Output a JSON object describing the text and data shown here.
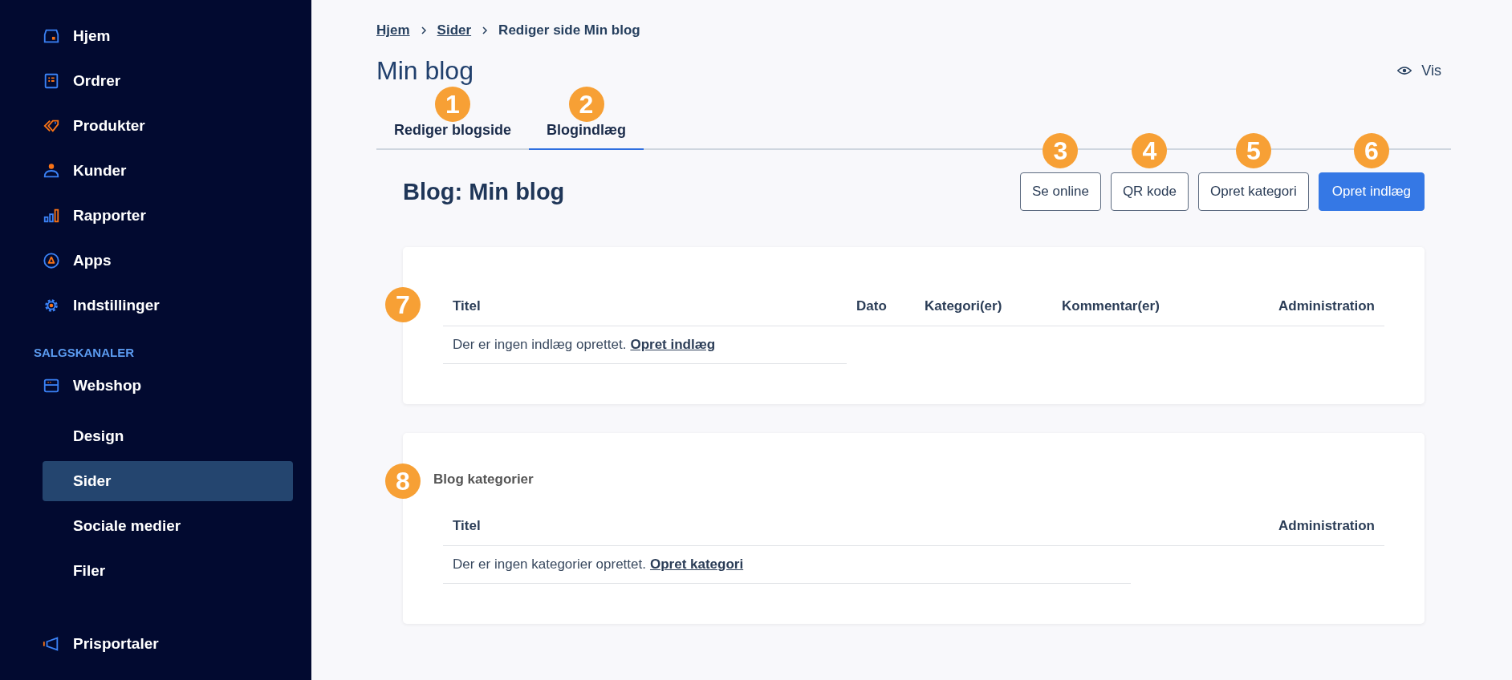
{
  "sidebar": {
    "items": [
      {
        "label": "Hjem",
        "selected": false
      },
      {
        "label": "Ordrer",
        "selected": false
      },
      {
        "label": "Produkter",
        "selected": false
      },
      {
        "label": "Kunder",
        "selected": false
      },
      {
        "label": "Rapporter",
        "selected": false
      },
      {
        "label": "Apps",
        "selected": false
      },
      {
        "label": "Indstillinger",
        "selected": false
      }
    ],
    "section_label": "SALGSKANALER",
    "channel": {
      "label": "Webshop",
      "children": [
        {
          "label": "Design",
          "selected": false
        },
        {
          "label": "Sider",
          "selected": true
        },
        {
          "label": "Sociale medier",
          "selected": false
        },
        {
          "label": "Filer",
          "selected": false
        }
      ]
    },
    "bottom_items": [
      {
        "label": "Prisportaler",
        "selected": false
      }
    ]
  },
  "breadcrumb": [
    {
      "label": "Hjem",
      "kind": "link"
    },
    {
      "label": "Sider",
      "kind": "link"
    },
    {
      "label": "Rediger side Min blog",
      "kind": "current"
    }
  ],
  "page_title": "Min blog",
  "view_link": "Vis",
  "tabs": [
    {
      "label": "Rediger blogside",
      "selected": false,
      "callout": "1"
    },
    {
      "label": "Blogindlæg",
      "selected": true,
      "callout": "2"
    }
  ],
  "blog_heading": "Blog: Min blog",
  "buttons": [
    {
      "label": "Se online",
      "kind": "secondary",
      "callout": "3"
    },
    {
      "label": "QR kode",
      "kind": "secondary",
      "callout": "4"
    },
    {
      "label": "Opret kategori",
      "kind": "secondary",
      "callout": "5"
    },
    {
      "label": "Opret indlæg",
      "kind": "primary",
      "callout": "6"
    }
  ],
  "posts_card": {
    "callout": "7",
    "columns": [
      "Titel",
      "Dato",
      "Kategori(er)",
      "Kommentar(er)",
      "Administration"
    ],
    "empty_text": "Der er ingen indlæg oprettet.",
    "empty_link": "Opret indlæg"
  },
  "categories_card": {
    "callout": "8",
    "title": "Blog kategorier",
    "columns": [
      "Titel",
      "Administration"
    ],
    "empty_text": "Der er ingen kategorier oprettet.",
    "empty_link": "Opret kategori"
  }
}
